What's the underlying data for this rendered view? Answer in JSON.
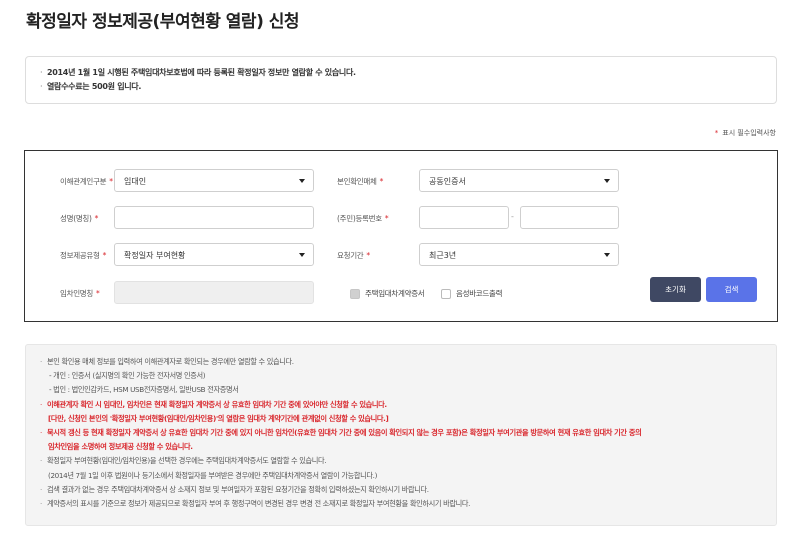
{
  "page": {
    "title": "확정일자 정보제공(부여현황 열람) 신청"
  },
  "info": {
    "lines": [
      "2014년 1월 1일 시행된 주택임대차보호법에 따라 등록된 확정일자 정보만 열람할 수 있습니다.",
      "열람수수료는 500원 입니다."
    ]
  },
  "required_note": "표시 필수입력사항",
  "form": {
    "relation_label": "이해관계인구분",
    "relation_value": "임대인",
    "auth_label": "본인확인매체",
    "auth_value": "공동인증서",
    "name_label": "성명(명칭)",
    "name_value": "",
    "regno_label": "(주민)등록번호",
    "regno_front": "",
    "regno_back": "",
    "regno_sep": "-",
    "infotype_label": "정보제공유형",
    "infotype_value": "확정일자 부여현황",
    "period_label": "요청기간",
    "period_value": "최근3년",
    "lessee_label": "임차인명칭",
    "lessee_value": "",
    "chk_contract_label": "주택임대차계약증서",
    "chk_barcode_label": "음성바코드출력",
    "reset_button": "초기화",
    "search_button": "검색",
    "required_mark": "*"
  },
  "notice": {
    "lines": [
      {
        "text": "본인 확인용 매체 정보를 입력하여 이해관계자로 확인되는 경우에만 열람할 수 있습니다.",
        "style": "dot"
      },
      {
        "text": "- 개인 : 인증서 (실지명의 확인 가능한 전자서명 인증서)",
        "style": "indent"
      },
      {
        "text": "- 법인 : 법인인감카드, HSM USB전자증명서, 일반USB 전자증명서",
        "style": "indent"
      },
      {
        "text": "이해관계자 확인 시 임대인, 임차인은 현재 확정일자 계약증서 상 유효한 임대차 기간 중에 있어야만 신청할 수 있습니다.",
        "style": "red-dot"
      },
      {
        "text": "[다만, 신청인 본인의 '확정일자 부여현황(임대인/임차인용)'의 열람은 임대차 계약기간에 관계없이 신청할 수 있습니다.]",
        "style": "red-indent"
      },
      {
        "text": "묵시적 갱신 등 현재 확정일자 계약증서 상 유효한 임대차 기간 중에 있지 아니한 임차인(유효한 임대차 기간 중에 있음이 확인되지 않는 경우 포함)은 확정일자 부여기관을 방문하여 현재 유효한 임대차 기간 중의",
        "style": "red-dot"
      },
      {
        "text": "임차인임을 소명하여 정보제공 신청할 수 있습니다.",
        "style": "red-indent"
      },
      {
        "text": "확정일자 부여현황(임대인/임차인용)을 선택한 경우에는 주택임대차계약증서도 열람할 수 있습니다.",
        "style": "dot"
      },
      {
        "text": "(2014년 7월 1일 이후 법원이나 등기소에서 확정일자를 부여받은 경우에만 주택임대차계약증서 열람이 가능합니다.)",
        "style": "indent"
      },
      {
        "text": "검색 결과가 없는 경우 주택임대차계약증서 상 소재지 정보 및 부여일자가 포함된 요청기간을 정확히 입력하셨는지 확인하시기 바랍니다.",
        "style": "dot"
      },
      {
        "text": "계약증서의 표시를 기준으로 정보가 제공되므로 확정일자 부여 후 행정구역이 변경된 경우 변경 전 소재지로 확정일자 부여현황을 확인하시기 바랍니다.",
        "style": "dot"
      }
    ]
  },
  "colors": {
    "required": "#d9262c",
    "reset_button": "#3f4863",
    "search_button": "#5a73e8"
  },
  "icons": {
    "select": "caret-down-icon"
  }
}
